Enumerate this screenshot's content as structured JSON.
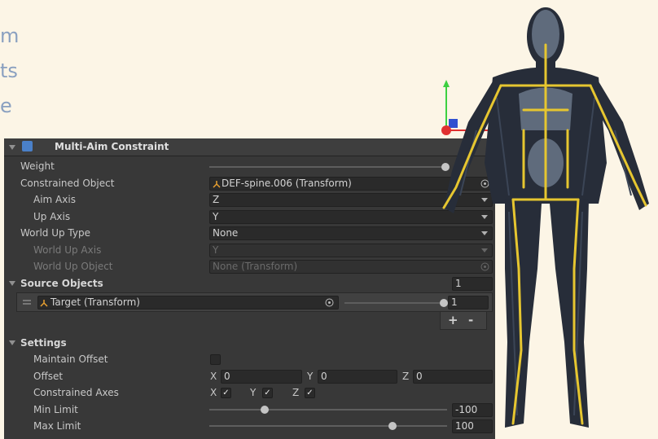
{
  "background_fragments": [
    "m",
    "ts",
    "e"
  ],
  "colors": {
    "panel": "#383838",
    "field": "#2a2a2a",
    "accent": "#e6c630",
    "highlight": "#4a6a9a"
  },
  "header": {
    "title": "Multi-Aim Constraint",
    "icon": "constraint-icon"
  },
  "properties": {
    "weight_label": "Weight",
    "constrained_object_label": "Constrained Object",
    "constrained_object_value": "DEF-spine.006 (Transform)",
    "aim_axis_label": "Aim Axis",
    "aim_axis_value": "Z",
    "up_axis_label": "Up Axis",
    "up_axis_value": "Y",
    "world_up_type_label": "World Up Type",
    "world_up_type_value": "None",
    "world_up_axis_label": "World Up Axis",
    "world_up_axis_value": "Y",
    "world_up_object_label": "World Up Object",
    "world_up_object_value": "None (Transform)"
  },
  "source_objects": {
    "label": "Source Objects",
    "count": "1",
    "items": [
      {
        "name": "Target (Transform)",
        "weight": "1"
      }
    ],
    "add_label": "+",
    "remove_label": "-"
  },
  "settings": {
    "label": "Settings",
    "maintain_offset_label": "Maintain Offset",
    "offset_label": "Offset",
    "offset_x_label": "X",
    "offset_x": "0",
    "offset_y_label": "Y",
    "offset_y": "0",
    "offset_z_label": "Z",
    "offset_z": "0",
    "constrained_axes_label": "Constrained Axes",
    "axis_x_label": "X",
    "axis_y_label": "Y",
    "axis_z_label": "Z",
    "check_mark": "✓",
    "min_limit_label": "Min Limit",
    "min_limit_value": "-100",
    "max_limit_label": "Max Limit",
    "max_limit_value": "100"
  }
}
